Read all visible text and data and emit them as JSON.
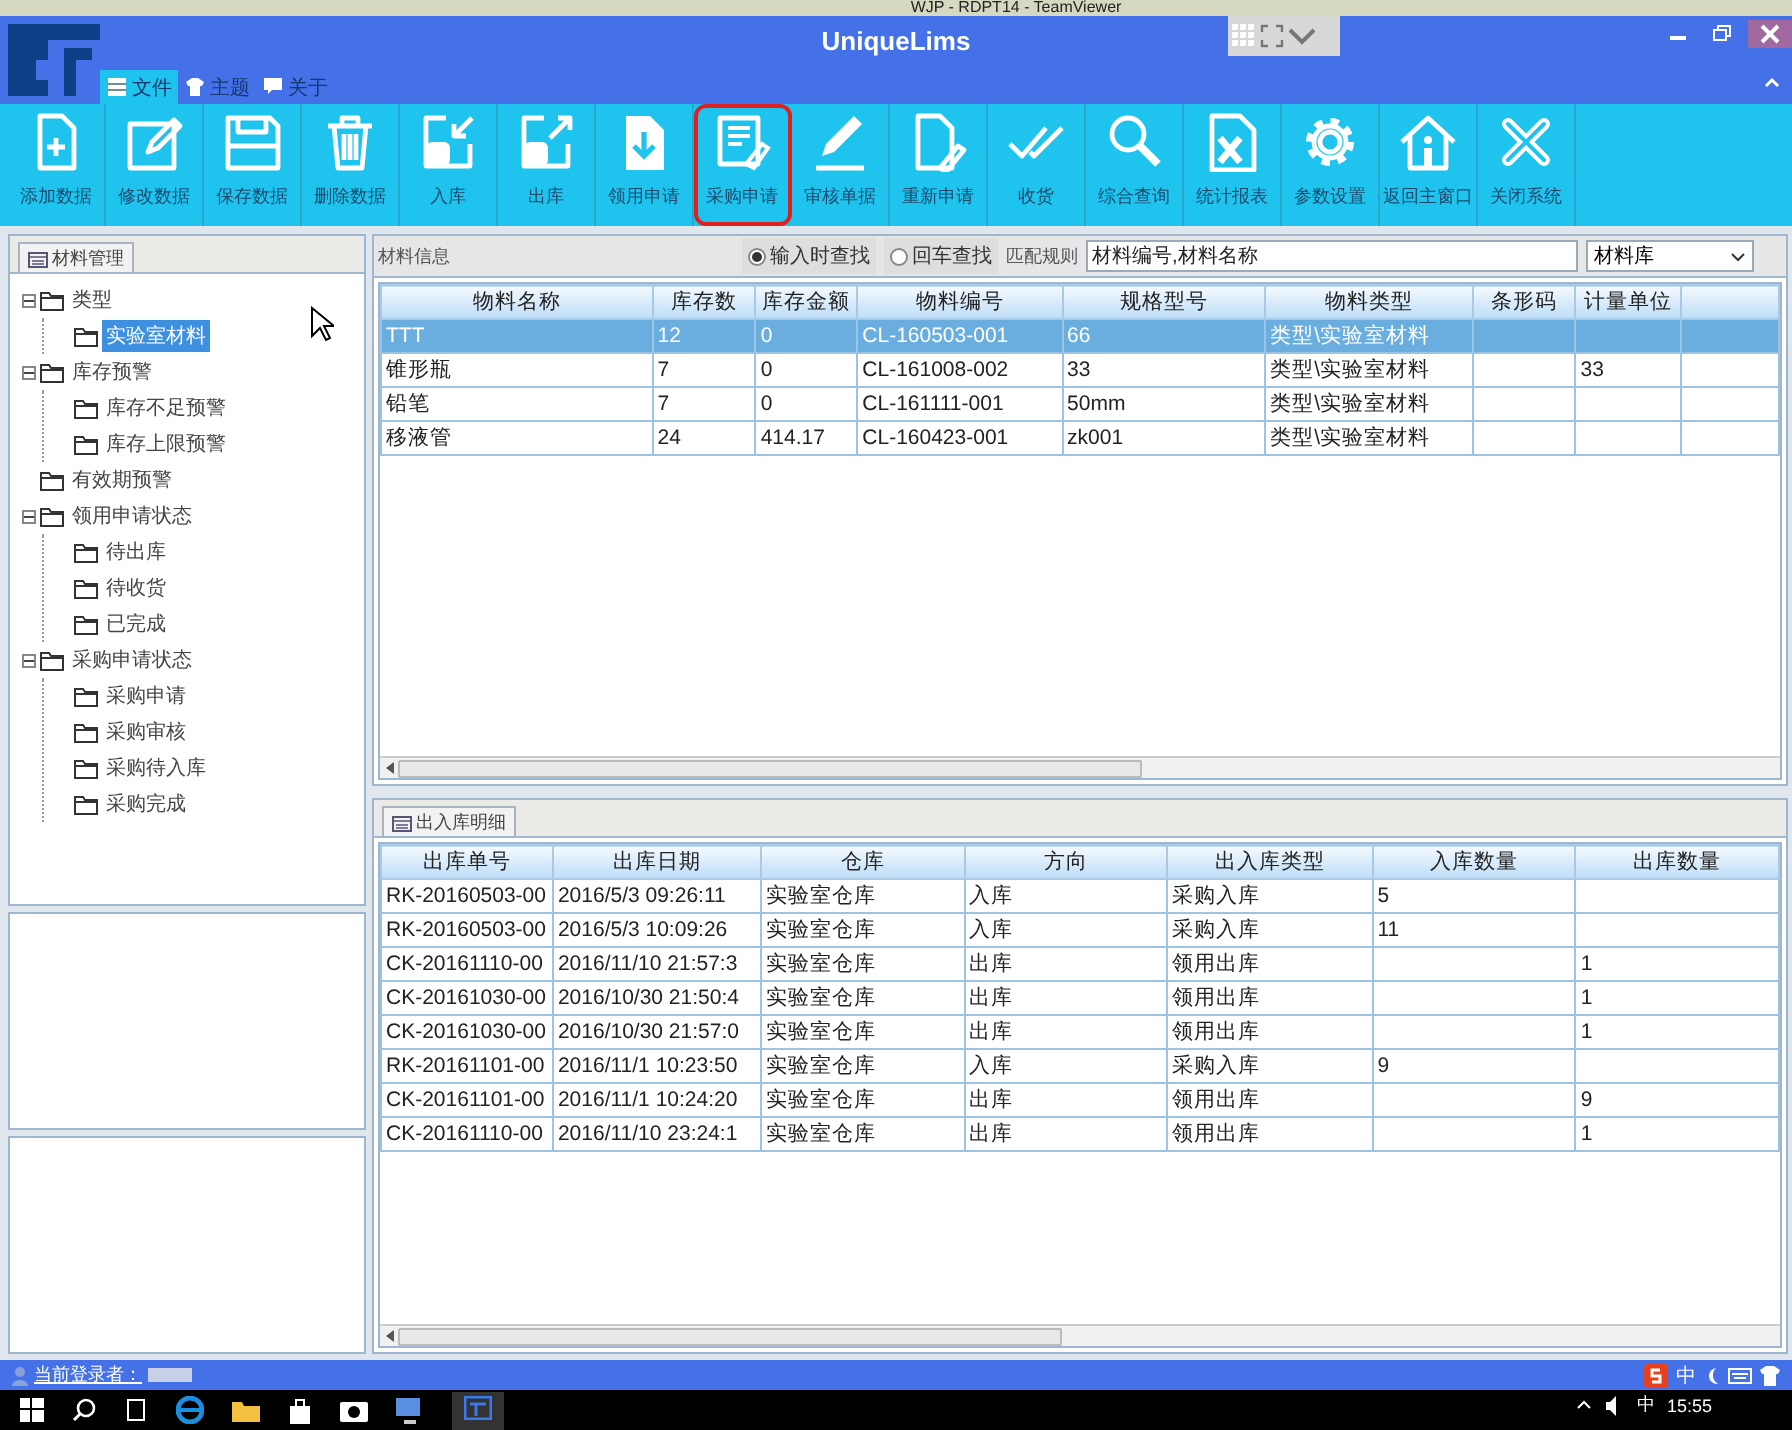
{
  "teamviewer_bar": {
    "title": "WJP - RDPT14 - TeamViewer"
  },
  "window": {
    "title": "UniqueLims"
  },
  "menu": [
    {
      "label": "文件",
      "selected": true
    },
    {
      "label": "主题",
      "selected": false
    },
    {
      "label": "关于",
      "selected": false
    }
  ],
  "toolbar": [
    {
      "label": "添加数据",
      "highlighted": false
    },
    {
      "label": "修改数据",
      "highlighted": false
    },
    {
      "label": "保存数据",
      "highlighted": false
    },
    {
      "label": "删除数据",
      "highlighted": false
    },
    {
      "label": "入库",
      "highlighted": false
    },
    {
      "label": "出库",
      "highlighted": false
    },
    {
      "label": "领用申请",
      "highlighted": false
    },
    {
      "label": "采购申请",
      "highlighted": true
    },
    {
      "label": "审核单据",
      "highlighted": false
    },
    {
      "label": "重新申请",
      "highlighted": false
    },
    {
      "label": "收货",
      "highlighted": false
    },
    {
      "label": "综合查询",
      "highlighted": false
    },
    {
      "label": "统计报表",
      "highlighted": false
    },
    {
      "label": "参数设置",
      "highlighted": false
    },
    {
      "label": "返回主窗口",
      "highlighted": false
    },
    {
      "label": "关闭系统",
      "highlighted": false
    }
  ],
  "tree_panel": {
    "tab": "材料管理",
    "items": [
      {
        "label": "类型",
        "expanded": true,
        "selected": false,
        "children": [
          {
            "label": "实验室材料",
            "selected": true
          }
        ]
      },
      {
        "label": "库存预警",
        "expanded": true,
        "selected": false,
        "children": [
          {
            "label": "库存不足预警",
            "selected": false
          },
          {
            "label": "库存上限预警",
            "selected": false
          }
        ]
      },
      {
        "label": "有效期预警",
        "selected": false
      },
      {
        "label": "领用申请状态",
        "expanded": true,
        "selected": false,
        "children": [
          {
            "label": "待出库",
            "selected": false
          },
          {
            "label": "待收货",
            "selected": false
          },
          {
            "label": "已完成",
            "selected": false
          }
        ]
      },
      {
        "label": "采购申请状态",
        "expanded": true,
        "selected": false,
        "children": [
          {
            "label": "采购申请",
            "selected": false
          },
          {
            "label": "采购审核",
            "selected": false
          },
          {
            "label": "采购待入库",
            "selected": false
          },
          {
            "label": "采购完成",
            "selected": false
          }
        ]
      }
    ]
  },
  "material_panel": {
    "title": "材料信息",
    "search_modes": [
      {
        "label": "输入时查找",
        "selected": true
      },
      {
        "label": "回车查找",
        "selected": false
      }
    ],
    "match_rule_label": "匹配规则",
    "match_rule": {
      "value": "材料编号,材料名称"
    },
    "library": {
      "value": "材料库"
    },
    "table": {
      "columns": [
        "物料名称",
        "库存数",
        "库存金额",
        "物料编号",
        "规格型号",
        "物料类型",
        "条形码",
        "计量单位"
      ],
      "rows": [
        {
          "selected": true,
          "cells": [
            "TTT",
            "12",
            "0",
            "CL-160503-001",
            "66",
            "类型\\实验室材料",
            "",
            ""
          ]
        },
        {
          "selected": false,
          "cells": [
            "锥形瓶",
            "7",
            "0",
            "CL-161008-002",
            "33",
            "类型\\实验室材料",
            "",
            "33"
          ]
        },
        {
          "selected": false,
          "cells": [
            "铅笔",
            "7",
            "0",
            "CL-161111-001",
            "50mm",
            "类型\\实验室材料",
            "",
            ""
          ]
        },
        {
          "selected": false,
          "cells": [
            "移液管",
            "24",
            "414.17",
            "CL-160423-001",
            "zk001",
            "类型\\实验室材料",
            "",
            ""
          ]
        }
      ]
    }
  },
  "detail_panel": {
    "tab": "出入库明细",
    "table": {
      "columns": [
        "出库单号",
        "出库日期",
        "仓库",
        "方向",
        "出入库类型",
        "入库数量",
        "出库数量"
      ],
      "rows": [
        [
          "RK-20160503-00",
          "2016/5/3 09:26:11",
          "实验室仓库",
          "入库",
          "采购入库",
          "5",
          ""
        ],
        [
          "RK-20160503-00",
          "2016/5/3 10:09:26",
          "实验室仓库",
          "入库",
          "采购入库",
          "11",
          ""
        ],
        [
          "CK-20161110-00",
          "2016/11/10 21:57:3",
          "实验室仓库",
          "出库",
          "领用出库",
          "",
          "1"
        ],
        [
          "CK-20161030-00",
          "2016/10/30 21:50:4",
          "实验室仓库",
          "出库",
          "领用出库",
          "",
          "1"
        ],
        [
          "CK-20161030-00",
          "2016/10/30 21:57:0",
          "实验室仓库",
          "出库",
          "领用出库",
          "",
          "1"
        ],
        [
          "RK-20161101-00",
          "2016/11/1 10:23:50",
          "实验室仓库",
          "入库",
          "采购入库",
          "9",
          ""
        ],
        [
          "CK-20161101-00",
          "2016/11/1 10:24:20",
          "实验室仓库",
          "出库",
          "领用出库",
          "",
          "9"
        ],
        [
          "CK-20161110-00",
          "2016/11/10 23:24:1",
          "实验室仓库",
          "出库",
          "领用出库",
          "",
          "1"
        ]
      ]
    }
  },
  "status_bar": {
    "label": "当前登录者：",
    "input_mode": "中"
  },
  "taskbar": {
    "input_mode": "中",
    "time": "15:55"
  }
}
